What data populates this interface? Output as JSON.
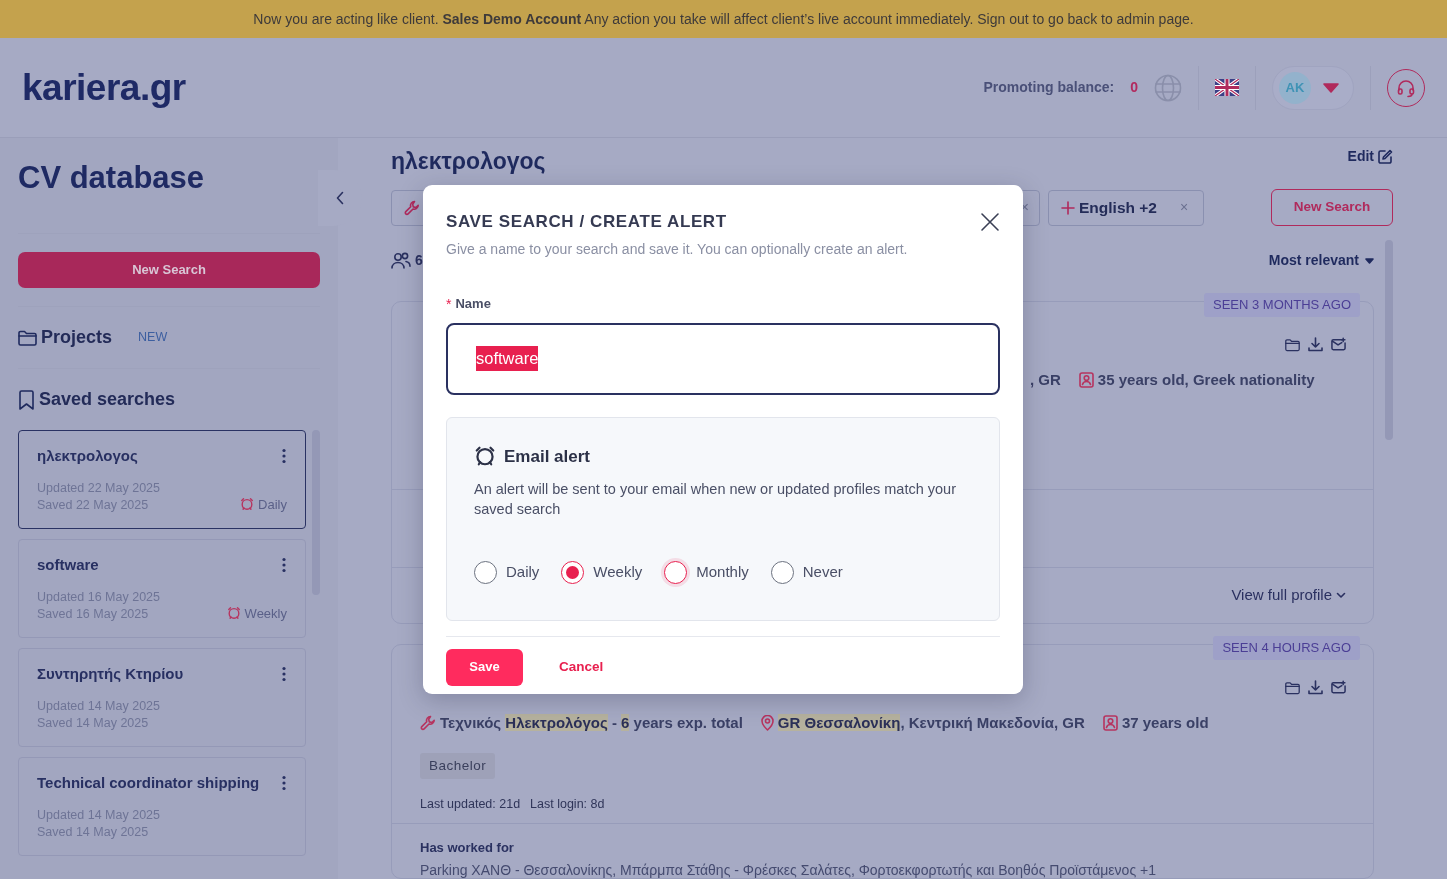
{
  "banner": {
    "text": "Now you are acting like client. **Sales Demo Account** Any action you take will affect client’s live account immediately. Sign out to go back to admin page."
  },
  "header": {
    "logo": "kariera.gr",
    "balance_label": "Promoting balance:",
    "balance_value": "0",
    "avatar_initials": "AK"
  },
  "sidebar": {
    "title": "CV database",
    "new_search": "New Search",
    "projects_label": "Projects",
    "projects_badge": "NEW",
    "saved_label": "Saved searches",
    "saved_searches": [
      {
        "name": "ηλεκτρολογος",
        "updated": "Updated  22 May 2025",
        "saved": "Saved  22 May 2025",
        "alert": "Daily",
        "selected": true
      },
      {
        "name": "software",
        "updated": "Updated  16 May 2025",
        "saved": "Saved  16 May 2025",
        "alert": "Weekly",
        "selected": false
      },
      {
        "name": "Συντηρητής Κτηρίου",
        "updated": "Updated  14 May 2025",
        "saved": "Saved  14 May 2025",
        "selected": false
      },
      {
        "name": "Technical coordinator shipping",
        "updated": "Updated  14 May 2025",
        "saved": "Saved  14 May 2025",
        "selected": false
      }
    ]
  },
  "main": {
    "title": "ηλεκτρολογος",
    "edit": "Edit",
    "filters": [
      {
        "kind": "skill",
        "remove": "×"
      },
      {
        "kind": "language",
        "label": "English +2",
        "remove": "×"
      }
    ],
    "new_search": "New Search",
    "results_count": "6",
    "sort": "Most relevant",
    "candidates": [
      {
        "seen": "SEEN 3 MONTHS AGO",
        "location": ", GR",
        "age": "35 years old, Greek nationality",
        "view_profile": "View full profile"
      },
      {
        "seen": "SEEN 4 HOURS AGO",
        "job": "Τεχνικός **Ηλεκτρολόγος** - **6** years exp. total",
        "location": "**GR Θεσσαλονίκη**, Κεντρική Μακεδονία, GR",
        "age": "37 years old",
        "tags": [
          "Bachelor"
        ],
        "last_updated": "Last updated: 21d",
        "last_login": "Last login: 8d",
        "worked_label": "Has worked for",
        "worked": "Parking ΧΑΝΘ - Θεσσαλονίκης, Μπάρμπα Στάθης - Φρέσκες Σαλάτες, Φορτοεκφορτωτής και Βοηθός Προϊστάμενος +1"
      }
    ]
  },
  "modal": {
    "title": "SAVE SEARCH / CREATE ALERT",
    "subtitle": "Give a name to your search and save it. You can optionally create an alert.",
    "name_label": "Name",
    "required_mark": "*",
    "name_value": "software",
    "value_selected": true,
    "alert": {
      "title": "Email alert",
      "description": "An alert will be sent to your email when new or updated profiles match your saved search",
      "options": [
        {
          "label": "Daily",
          "selected": false,
          "hover": false
        },
        {
          "label": "Weekly",
          "selected": true,
          "hover": false
        },
        {
          "label": "Monthly",
          "selected": false,
          "hover": true
        },
        {
          "label": "Never",
          "selected": false,
          "hover": false
        }
      ]
    },
    "save": "Save",
    "cancel": "Cancel"
  }
}
